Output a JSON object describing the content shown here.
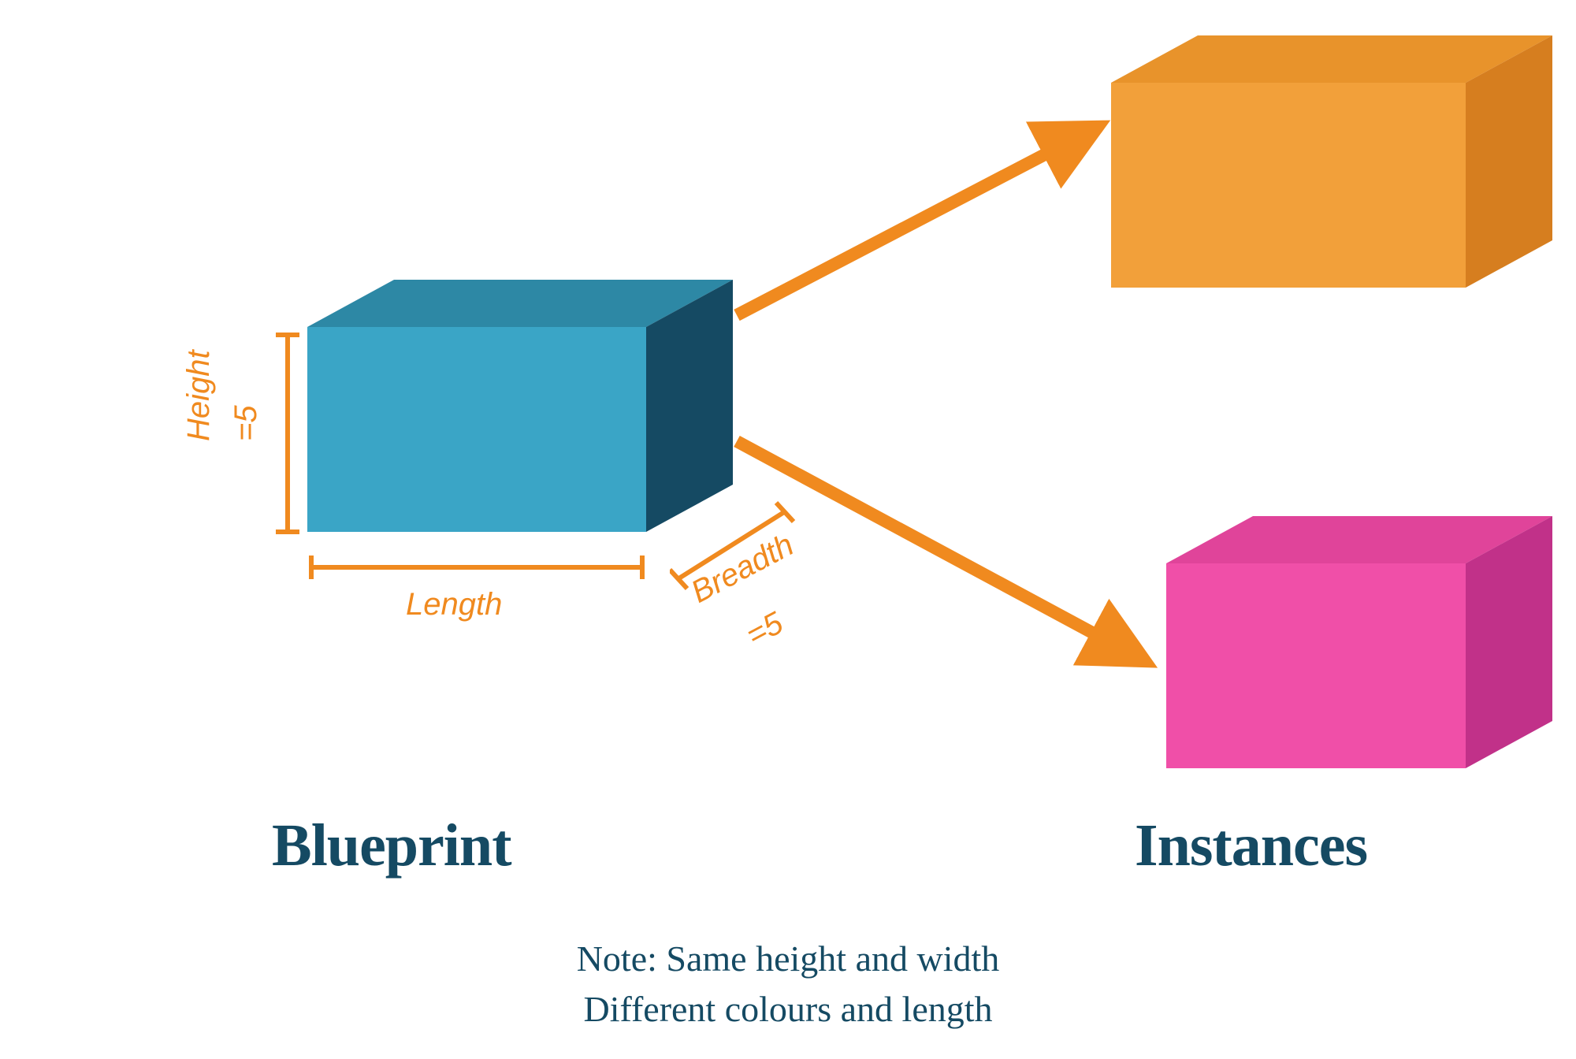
{
  "dimensions": {
    "height_label": "Height",
    "height_value": "=5",
    "length_label": "Length",
    "breadth_label": "Breadth",
    "breadth_value": "=5"
  },
  "headings": {
    "left": "Blueprint",
    "right": "Instances"
  },
  "note": {
    "line1": "Note: Same height and width",
    "line2": "Different colours and length"
  },
  "colors": {
    "blueprint_cube": {
      "front": "#3aa5c6",
      "side": "#154a63",
      "top": "#2d88a5"
    },
    "instance_orange": {
      "front": "#f2a03a",
      "side": "#d67e1f",
      "top": "#e8932b"
    },
    "instance_pink": {
      "front": "#f04fa8",
      "side": "#c13189",
      "top": "#e0449a"
    },
    "arrow": "#f08a1f",
    "annotation": "#f08a1f",
    "heading": "#154a63"
  }
}
